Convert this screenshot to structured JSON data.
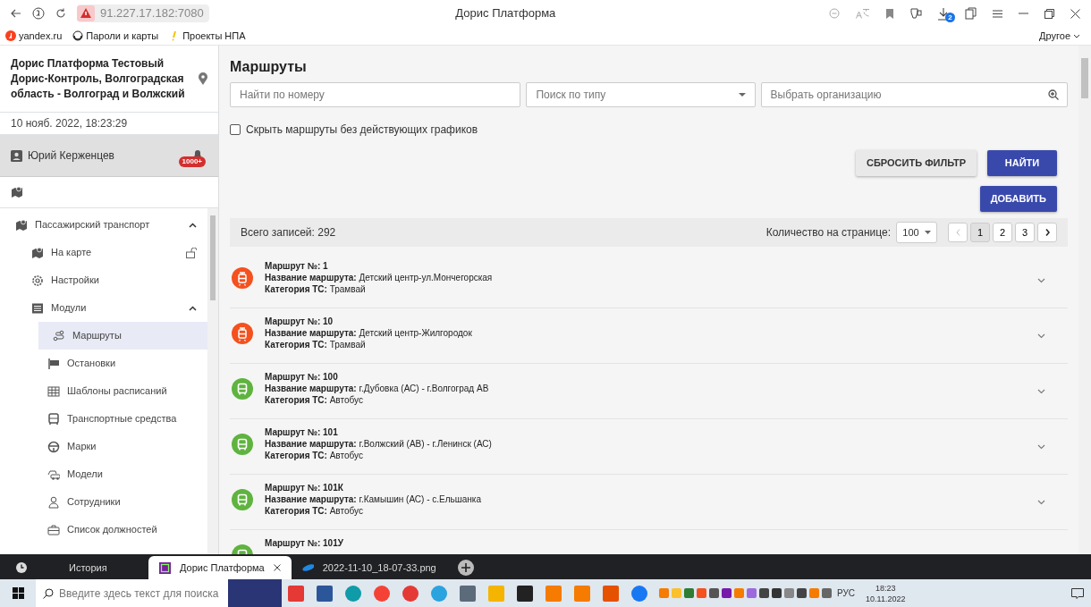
{
  "browser": {
    "address": "91.227.17.182:7080",
    "title": "Дорис Платформа",
    "download_count": "2",
    "bookmarks": [
      {
        "label": "yandex.ru",
        "kind": "yandex"
      },
      {
        "label": "Пароли и карты",
        "kind": "keys"
      },
      {
        "label": "Проекты НПА",
        "kind": "pin"
      }
    ],
    "other_bookmarks": "Другое"
  },
  "sidebar": {
    "organization": "Дорис Платформа Тестовый Дорис-Контроль, Волгоградская область - Волгоград и Волжский",
    "datetime": "10 нояб. 2022, 18:23:29",
    "user": "Юрий Керженцев",
    "notifications": "1000+",
    "menu": [
      {
        "label": "Пассажирский транспорт",
        "expanded": true,
        "selected": false,
        "children": [
          {
            "label": "На карте",
            "selected": false,
            "locked": false
          },
          {
            "label": "Настройки",
            "selected": false
          },
          {
            "label": "Модули",
            "expanded": true,
            "selected": false,
            "children": [
              {
                "label": "Маршруты",
                "selected": true
              },
              {
                "label": "Остановки",
                "selected": false
              },
              {
                "label": "Шаблоны расписаний",
                "selected": false
              },
              {
                "label": "Транспортные средства",
                "selected": false
              },
              {
                "label": "Марки",
                "selected": false
              },
              {
                "label": "Модели",
                "selected": false
              },
              {
                "label": "Сотрудники",
                "selected": false
              },
              {
                "label": "Список должностей",
                "selected": false
              }
            ]
          }
        ]
      }
    ]
  },
  "main": {
    "title": "Маршруты",
    "filters": {
      "number": {
        "placeholder": "Найти по номеру"
      },
      "type": {
        "placeholder": "Поиск по типу"
      },
      "organization": {
        "placeholder": "Выбрать организацию"
      }
    },
    "hide_without_schedules": {
      "label": "Скрыть маршруты без действующих графиков",
      "checked": false
    },
    "buttons": [
      {
        "label": "СБРОСИТЬ ФИЛЬТР",
        "kind": "secondary"
      },
      {
        "label": "НАЙТИ",
        "kind": "primary"
      }
    ],
    "add_button": "ДОБАВИТЬ",
    "total": "Всего записей: 292",
    "page_size_label": "Количество на странице:",
    "page_size": "100",
    "pagination": {
      "prev_disabled": true,
      "pages": [
        {
          "label": "1",
          "selected": true
        },
        {
          "label": "2",
          "selected": false
        },
        {
          "label": "3",
          "selected": false
        }
      ]
    },
    "routes": [
      {
        "kind": "tram",
        "lines": [
          "Маршрут №: 1",
          "**Название маршрута:** Детский центр-ул.Мончегорская",
          "**Категория ТС:** Трамвай"
        ]
      },
      {
        "kind": "tram",
        "lines": [
          "Маршрут №: 10",
          "**Название маршрута:** Детский центр-Жилгородок",
          "**Категория ТС:** Трамвай"
        ]
      },
      {
        "kind": "bus",
        "lines": [
          "Маршрут №: 100",
          "**Название маршрута:** г.Дубовка (АС) - г.Волгоград АВ",
          "**Категория ТС:** Автобус"
        ]
      },
      {
        "kind": "bus",
        "lines": [
          "Маршрут №: 101",
          "**Название маршрута:** г.Волжский (АВ) - г.Ленинск (АС)",
          "**Категория ТС:** Автобус"
        ]
      },
      {
        "kind": "bus",
        "lines": [
          "Маршрут №: 101К",
          "**Название маршрута:** г.Камышин (АС) - с.Ельшанка",
          "**Категория ТС:** Автобус"
        ]
      },
      {
        "kind": "bus",
        "lines": [
          "Маршрут №: 101У"
        ]
      }
    ]
  },
  "browser_tabs": [
    {
      "label": "История",
      "kind": "history",
      "selected": false
    },
    {
      "label": "Дорис Платформа",
      "kind": "app",
      "selected": true
    },
    {
      "label": "2022-11-10_18-07-33.png",
      "kind": "image",
      "selected": false
    }
  ],
  "taskbar": {
    "search": {
      "placeholder": "Введите здесь текст для поиска"
    },
    "language": "РУС",
    "time": "18:23",
    "date": "10.11.2022"
  }
}
